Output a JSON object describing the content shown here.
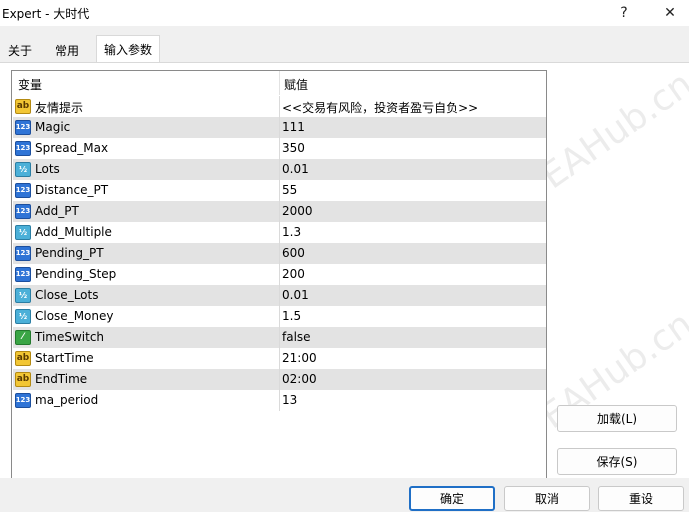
{
  "window": {
    "title": "Expert - 大时代",
    "help_label": "?",
    "close_label": "✕"
  },
  "tabs": [
    {
      "label": "关于"
    },
    {
      "label": "常用"
    },
    {
      "label": "输入参数"
    }
  ],
  "grid": {
    "col_variable": "变量",
    "col_value": "赋值",
    "rows": [
      {
        "type": "ab",
        "name": "友情提示",
        "value": "<<交易有风险，投资者盈亏自负>>"
      },
      {
        "type": "123",
        "name": "Magic",
        "value": "111"
      },
      {
        "type": "123",
        "name": "Spread_Max",
        "value": "350"
      },
      {
        "type": "half",
        "name": "Lots",
        "value": "0.01"
      },
      {
        "type": "123",
        "name": "Distance_PT",
        "value": "55"
      },
      {
        "type": "123",
        "name": "Add_PT",
        "value": "2000"
      },
      {
        "type": "half",
        "name": "Add_Multiple",
        "value": "1.3"
      },
      {
        "type": "123",
        "name": "Pending_PT",
        "value": "600"
      },
      {
        "type": "123",
        "name": "Pending_Step",
        "value": "200"
      },
      {
        "type": "half",
        "name": "Close_Lots",
        "value": "0.01"
      },
      {
        "type": "half",
        "name": "Close_Money",
        "value": "1.5"
      },
      {
        "type": "bool",
        "name": "TimeSwitch",
        "value": "false"
      },
      {
        "type": "ab",
        "name": "StartTime",
        "value": "21:00"
      },
      {
        "type": "ab",
        "name": "EndTime",
        "value": "02:00"
      },
      {
        "type": "123",
        "name": "ma_period",
        "value": "13"
      }
    ]
  },
  "icons": {
    "ab": {
      "glyph": "ab",
      "name": "string-type-icon"
    },
    "123": {
      "glyph": "123",
      "name": "integer-type-icon"
    },
    "half": {
      "glyph": "½",
      "name": "double-type-icon"
    },
    "bool": {
      "glyph": "⁄",
      "name": "bool-type-icon"
    }
  },
  "side_buttons": {
    "load": "加载(L)",
    "save": "保存(S)"
  },
  "footer_buttons": {
    "ok": "确定",
    "cancel": "取消",
    "reset": "重设"
  },
  "watermark": "EAHub.cn",
  "colors": {
    "accent": "#1f6fc6",
    "alt_row": "#e3e3e3"
  }
}
